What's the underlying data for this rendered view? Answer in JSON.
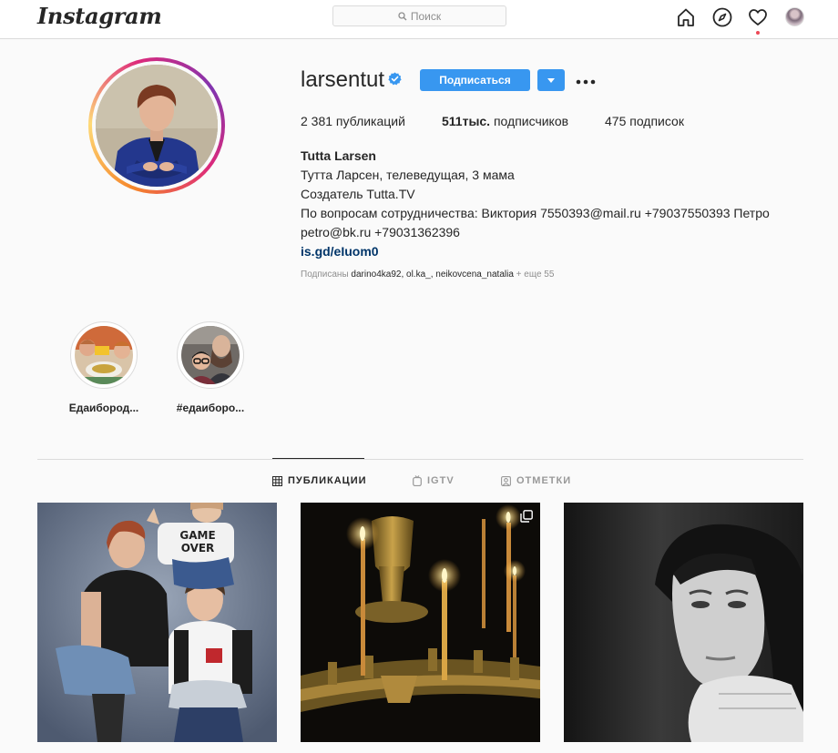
{
  "nav": {
    "logo": "Instagram",
    "search_placeholder": "Поиск",
    "icons": [
      "home-icon",
      "explore-compass-icon",
      "activity-heart-icon",
      "profile-avatar"
    ]
  },
  "profile": {
    "username": "larsentut",
    "verified": true,
    "follow_label": "Подписаться",
    "stats": {
      "posts_count": "2 381",
      "posts_label": " публикаций",
      "followers_count": "511тыс.",
      "followers_label": " подписчиков",
      "following_count": "475",
      "following_label": " подписок"
    },
    "full_name": "Tutta Larsen",
    "bio_lines": [
      "Тутта Ларсен, телеведущая, 3 мама",
      "Создатель Tutta.TV",
      "По вопросам сотрудничества: Виктория 7550393@mail.ru +79037550393 Петро",
      "petro@bk.ru +79031362396"
    ],
    "website": "is.gd/eIuom0",
    "followed_by_prefix": "Подписаны ",
    "followed_by_names": "darino4ka92, ol.ka_, neikovcena_natalia",
    "followed_by_more": " + еще 55"
  },
  "highlights": [
    {
      "label": "Едаибород..."
    },
    {
      "label": "#едаиборо..."
    }
  ],
  "tabs": {
    "posts": "ПУБЛИКАЦИИ",
    "igtv": "IGTV",
    "tagged": "ОТМЕТКИ"
  },
  "colors": {
    "accent": "#3897f0",
    "link": "#003569",
    "notification": "#ed4956"
  }
}
